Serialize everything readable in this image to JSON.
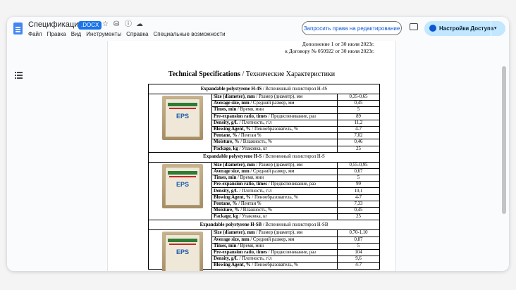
{
  "header": {
    "doc_title": "Спецификация",
    "file_badge": ".DOCX",
    "menu": [
      "Файл",
      "Правка",
      "Вид",
      "Инструменты",
      "Справка",
      "Специальные возможности"
    ],
    "request_edit": "Запросить права на редактирование",
    "share_label": "Настройки Доступа",
    "share_dropdown": "▾",
    "icons": {
      "star": "☆",
      "drive": "⛁",
      "info": "ⓘ",
      "cloud": "☁"
    }
  },
  "doc": {
    "addendum_line1": "Дополнение 1 от 30 июля 2023г.",
    "addendum_line2": "к Договору № 050922 от 30 июля 2023г.",
    "heading_en": "Technical Specifications",
    "heading_ru": " / Технические Характеристики",
    "bag_label": "EPS",
    "products": [
      {
        "name_en": "Expandable polystyrene H-4S",
        "name_ru": " / Вспененный полистирол H-4S",
        "rows": [
          {
            "en": "Size (diameter), mm",
            "ru": " / Размер (диаметр), мм",
            "val": "0,35-0,65"
          },
          {
            "en": "Average size, mm",
            "ru": " / Средний размер, мм",
            "val": "0,45"
          },
          {
            "en": "Times, min",
            "ru": " / Время, мин",
            "val": "5"
          },
          {
            "en": "Pre-expansion ratio, times",
            "ru": " / Предвспенивание, раз",
            "val": "89"
          },
          {
            "en": "Density, g/L",
            "ru": " / Плотность, г/л",
            "val": "11,2"
          },
          {
            "en": "Blowing Agent, %",
            "ru": " / Пенообразователь, %",
            "val": "4-7"
          },
          {
            "en": "Pentane, %",
            "ru": " / Пентан %",
            "val": "7,02"
          },
          {
            "en": "Moisture, %",
            "ru": " / Влажность, %",
            "val": "0,46"
          },
          {
            "en": "Package, kg",
            "ru": " / Упаковка, кг",
            "val": "25"
          }
        ]
      },
      {
        "name_en": "Expandable polystyrene H-S",
        "name_ru": " / Вспененный полистирол H-S",
        "rows": [
          {
            "en": "Size (diameter), mm",
            "ru": " / Размер (диаметр), мм",
            "val": "0,55-0,95"
          },
          {
            "en": "Average size, mm",
            "ru": " / Средний размер, мм",
            "val": "0,67"
          },
          {
            "en": "Times, min",
            "ru": " / Время, мин",
            "val": "5"
          },
          {
            "en": "Pre-expansion ratio, times",
            "ru": " / Предвспенивание, раз",
            "val": "99"
          },
          {
            "en": "Density, g/L",
            "ru": " / Плотность, г/л",
            "val": "10,1"
          },
          {
            "en": "Blowing Agent, %",
            "ru": " / Пенообразователь, %",
            "val": "4-7"
          },
          {
            "en": "Pentane, %",
            "ru": " / Пентан %",
            "val": "7,33"
          },
          {
            "en": "Moisture, %",
            "ru": " / Влажность, %",
            "val": "0,45"
          },
          {
            "en": "Package, kg",
            "ru": " / Упаковка, кг",
            "val": "25"
          }
        ]
      },
      {
        "name_en": "Expandable polystyrene H-SB",
        "name_ru": " / Вспененный полистирол H-SB",
        "rows": [
          {
            "en": "Size (diameter), mm",
            "ru": " / Размер (диаметр), мм",
            "val": "0,70-1,10"
          },
          {
            "en": "Average size, mm",
            "ru": " / Средний размер, мм",
            "val": "0,87"
          },
          {
            "en": "Times, min",
            "ru": " / Время, мин",
            "val": "5"
          },
          {
            "en": "Pre-expansion ratio, times",
            "ru": " / Предвспенивание, раз",
            "val": "104"
          },
          {
            "en": "Density, g/L",
            "ru": " / Плотность, г/л",
            "val": "9,6"
          },
          {
            "en": "Blowing Agent, %",
            "ru": " / Пенообразователь, %",
            "val": "4-7"
          }
        ]
      }
    ]
  },
  "colors": {
    "accent": "#1a73e8",
    "share_bg": "#c2e7ff",
    "page_bg": "#f9fbfd"
  }
}
